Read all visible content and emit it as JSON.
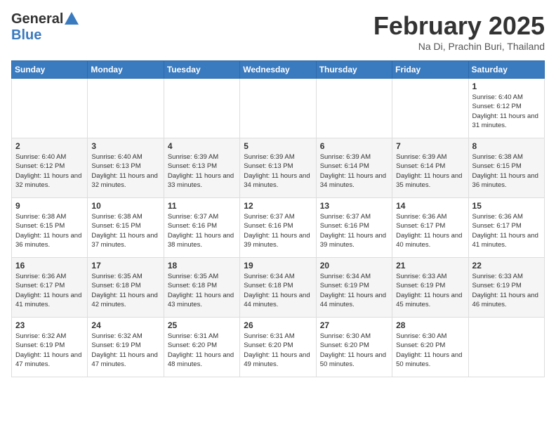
{
  "header": {
    "logo_general": "General",
    "logo_blue": "Blue",
    "month_title": "February 2025",
    "location": "Na Di, Prachin Buri, Thailand"
  },
  "days_of_week": [
    "Sunday",
    "Monday",
    "Tuesday",
    "Wednesday",
    "Thursday",
    "Friday",
    "Saturday"
  ],
  "weeks": [
    {
      "row_class": "row-odd",
      "days": [
        {
          "num": "",
          "info": ""
        },
        {
          "num": "",
          "info": ""
        },
        {
          "num": "",
          "info": ""
        },
        {
          "num": "",
          "info": ""
        },
        {
          "num": "",
          "info": ""
        },
        {
          "num": "",
          "info": ""
        },
        {
          "num": "1",
          "info": "Sunrise: 6:40 AM\nSunset: 6:12 PM\nDaylight: 11 hours and 31 minutes."
        }
      ]
    },
    {
      "row_class": "row-even",
      "days": [
        {
          "num": "2",
          "info": "Sunrise: 6:40 AM\nSunset: 6:12 PM\nDaylight: 11 hours and 32 minutes."
        },
        {
          "num": "3",
          "info": "Sunrise: 6:40 AM\nSunset: 6:13 PM\nDaylight: 11 hours and 32 minutes."
        },
        {
          "num": "4",
          "info": "Sunrise: 6:39 AM\nSunset: 6:13 PM\nDaylight: 11 hours and 33 minutes."
        },
        {
          "num": "5",
          "info": "Sunrise: 6:39 AM\nSunset: 6:13 PM\nDaylight: 11 hours and 34 minutes."
        },
        {
          "num": "6",
          "info": "Sunrise: 6:39 AM\nSunset: 6:14 PM\nDaylight: 11 hours and 34 minutes."
        },
        {
          "num": "7",
          "info": "Sunrise: 6:39 AM\nSunset: 6:14 PM\nDaylight: 11 hours and 35 minutes."
        },
        {
          "num": "8",
          "info": "Sunrise: 6:38 AM\nSunset: 6:15 PM\nDaylight: 11 hours and 36 minutes."
        }
      ]
    },
    {
      "row_class": "row-odd",
      "days": [
        {
          "num": "9",
          "info": "Sunrise: 6:38 AM\nSunset: 6:15 PM\nDaylight: 11 hours and 36 minutes."
        },
        {
          "num": "10",
          "info": "Sunrise: 6:38 AM\nSunset: 6:15 PM\nDaylight: 11 hours and 37 minutes."
        },
        {
          "num": "11",
          "info": "Sunrise: 6:37 AM\nSunset: 6:16 PM\nDaylight: 11 hours and 38 minutes."
        },
        {
          "num": "12",
          "info": "Sunrise: 6:37 AM\nSunset: 6:16 PM\nDaylight: 11 hours and 39 minutes."
        },
        {
          "num": "13",
          "info": "Sunrise: 6:37 AM\nSunset: 6:16 PM\nDaylight: 11 hours and 39 minutes."
        },
        {
          "num": "14",
          "info": "Sunrise: 6:36 AM\nSunset: 6:17 PM\nDaylight: 11 hours and 40 minutes."
        },
        {
          "num": "15",
          "info": "Sunrise: 6:36 AM\nSunset: 6:17 PM\nDaylight: 11 hours and 41 minutes."
        }
      ]
    },
    {
      "row_class": "row-even",
      "days": [
        {
          "num": "16",
          "info": "Sunrise: 6:36 AM\nSunset: 6:17 PM\nDaylight: 11 hours and 41 minutes."
        },
        {
          "num": "17",
          "info": "Sunrise: 6:35 AM\nSunset: 6:18 PM\nDaylight: 11 hours and 42 minutes."
        },
        {
          "num": "18",
          "info": "Sunrise: 6:35 AM\nSunset: 6:18 PM\nDaylight: 11 hours and 43 minutes."
        },
        {
          "num": "19",
          "info": "Sunrise: 6:34 AM\nSunset: 6:18 PM\nDaylight: 11 hours and 44 minutes."
        },
        {
          "num": "20",
          "info": "Sunrise: 6:34 AM\nSunset: 6:19 PM\nDaylight: 11 hours and 44 minutes."
        },
        {
          "num": "21",
          "info": "Sunrise: 6:33 AM\nSunset: 6:19 PM\nDaylight: 11 hours and 45 minutes."
        },
        {
          "num": "22",
          "info": "Sunrise: 6:33 AM\nSunset: 6:19 PM\nDaylight: 11 hours and 46 minutes."
        }
      ]
    },
    {
      "row_class": "row-odd",
      "days": [
        {
          "num": "23",
          "info": "Sunrise: 6:32 AM\nSunset: 6:19 PM\nDaylight: 11 hours and 47 minutes."
        },
        {
          "num": "24",
          "info": "Sunrise: 6:32 AM\nSunset: 6:19 PM\nDaylight: 11 hours and 47 minutes."
        },
        {
          "num": "25",
          "info": "Sunrise: 6:31 AM\nSunset: 6:20 PM\nDaylight: 11 hours and 48 minutes."
        },
        {
          "num": "26",
          "info": "Sunrise: 6:31 AM\nSunset: 6:20 PM\nDaylight: 11 hours and 49 minutes."
        },
        {
          "num": "27",
          "info": "Sunrise: 6:30 AM\nSunset: 6:20 PM\nDaylight: 11 hours and 50 minutes."
        },
        {
          "num": "28",
          "info": "Sunrise: 6:30 AM\nSunset: 6:20 PM\nDaylight: 11 hours and 50 minutes."
        },
        {
          "num": "",
          "info": ""
        }
      ]
    }
  ]
}
